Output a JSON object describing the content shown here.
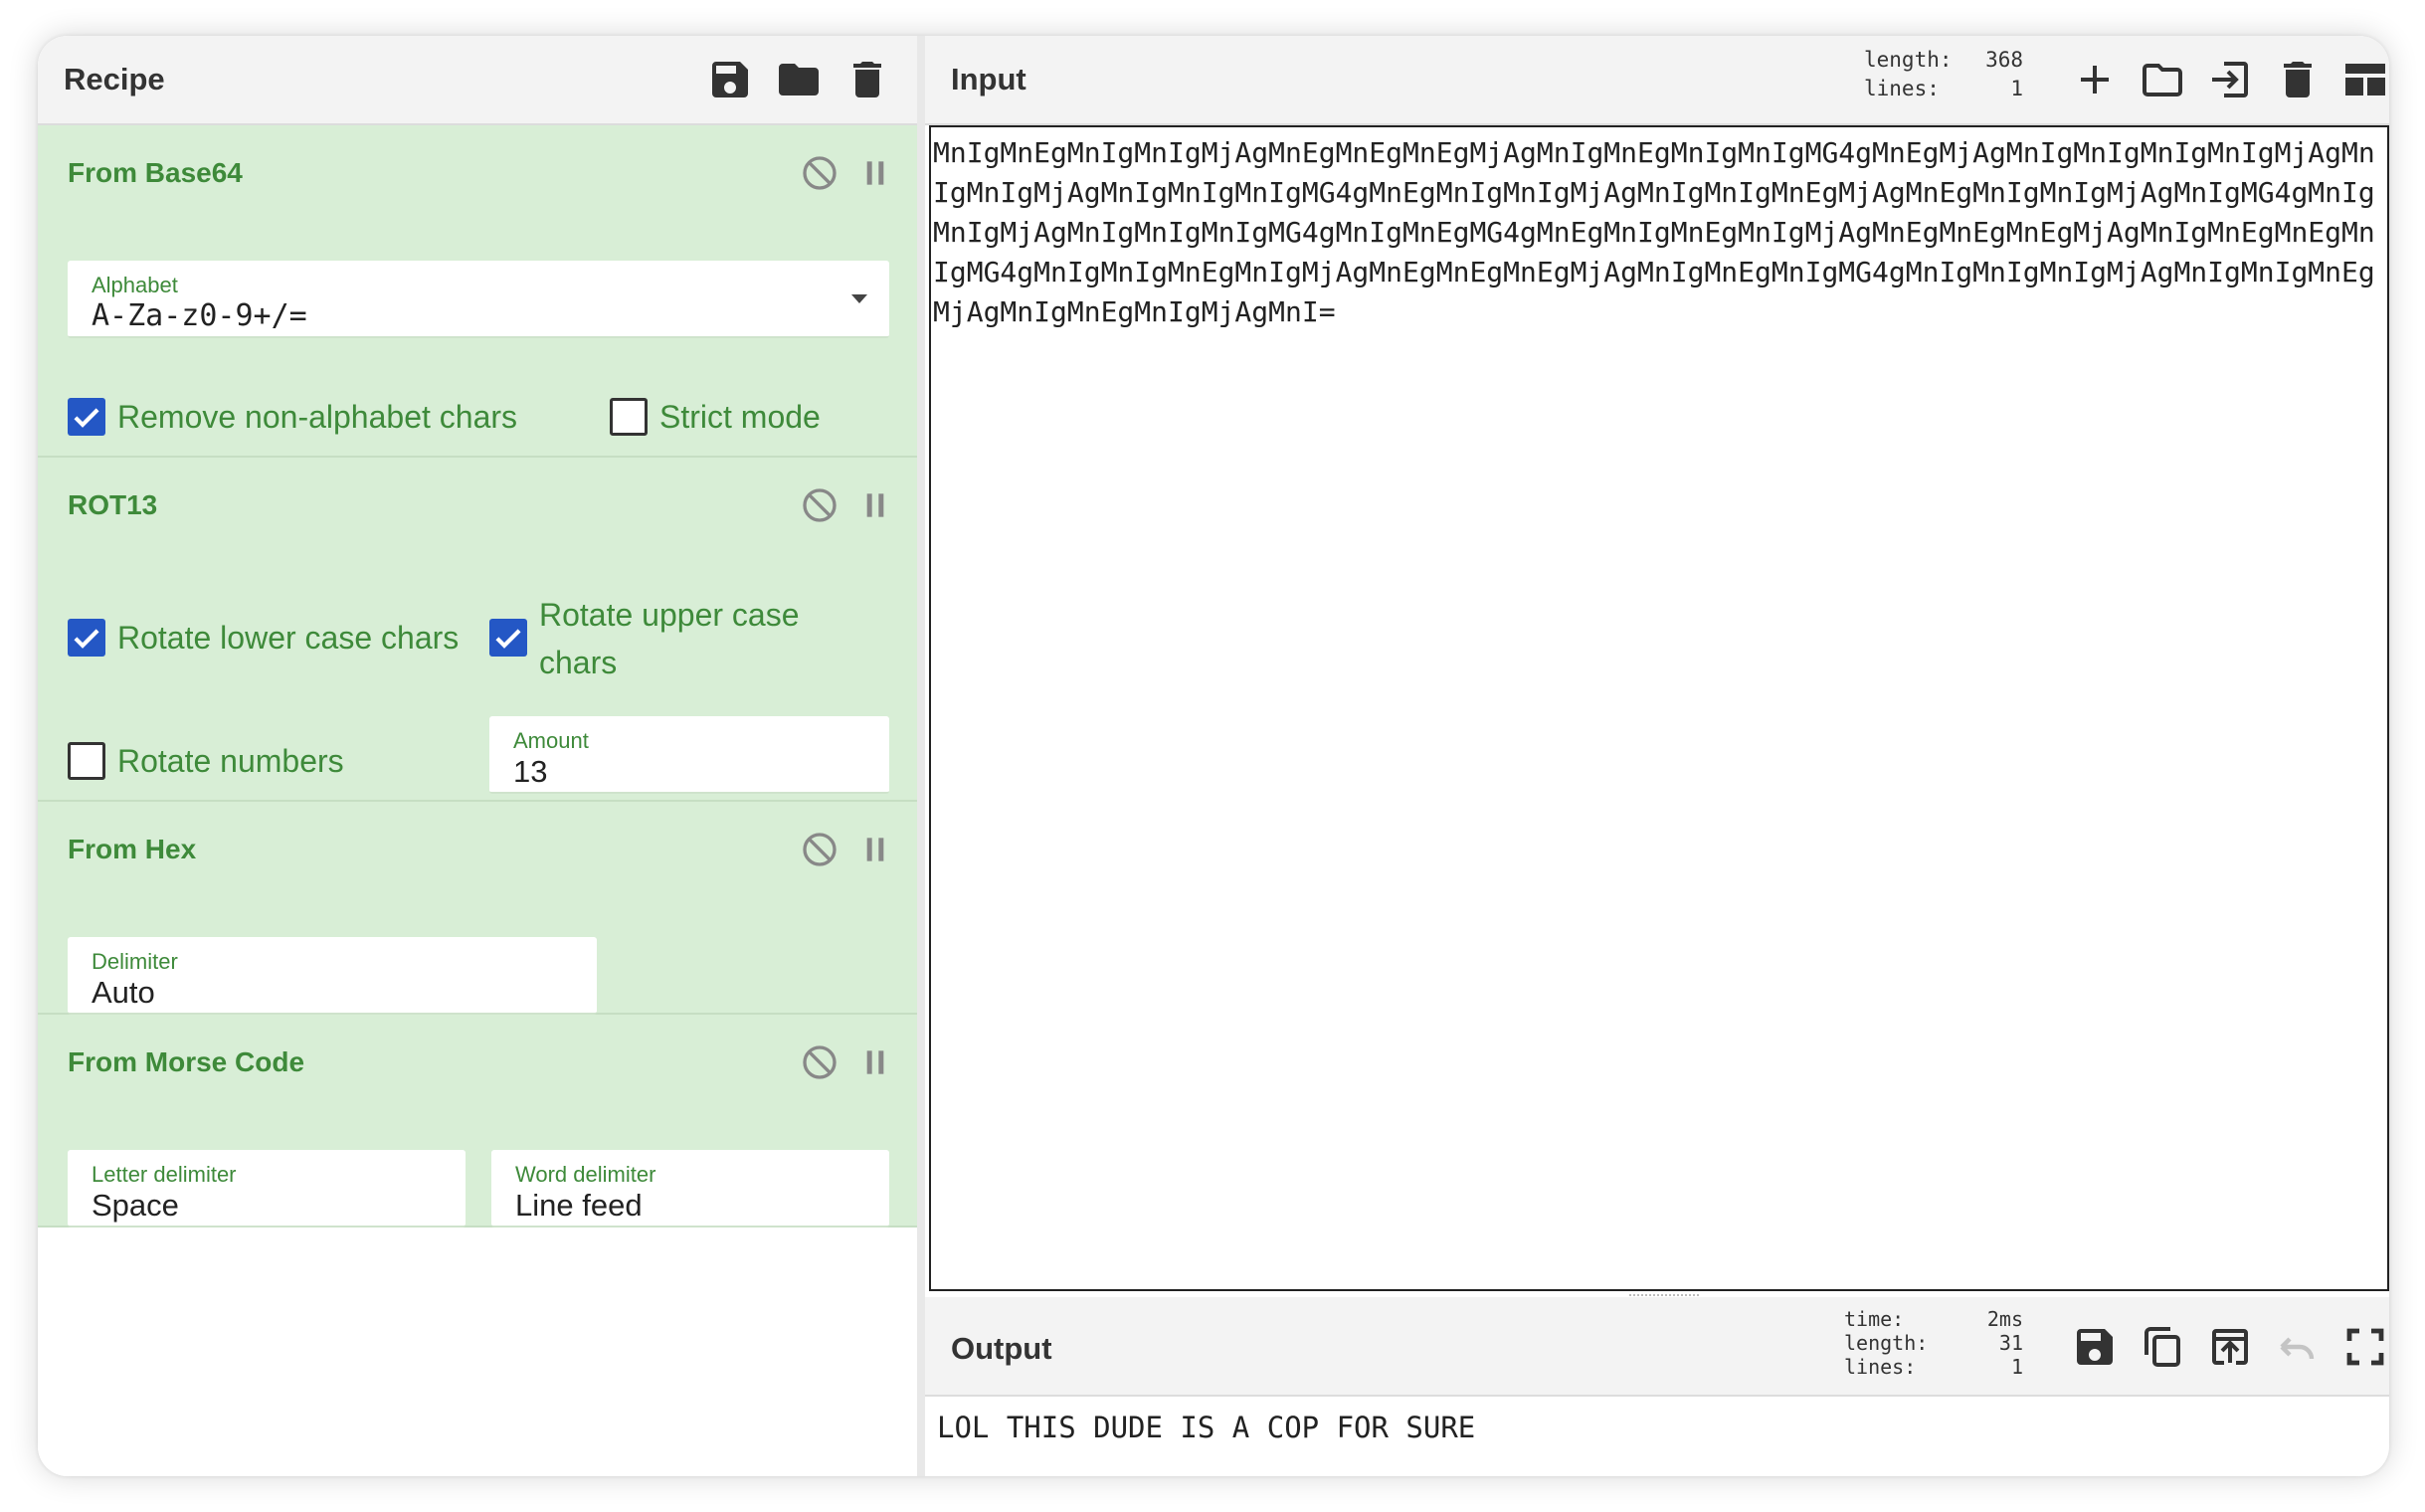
{
  "recipe": {
    "title": "Recipe",
    "icons": [
      "save-icon",
      "folder-icon",
      "trash-icon"
    ],
    "operations": [
      {
        "name": "From Base64",
        "fields": [
          {
            "label": "Alphabet",
            "value": "A-Za-z0-9+/=",
            "type": "dropdown"
          }
        ],
        "checkboxes": [
          {
            "label": "Remove non-alphabet chars",
            "checked": true
          },
          {
            "label": "Strict mode",
            "checked": false
          }
        ]
      },
      {
        "name": "ROT13",
        "checkboxes": [
          {
            "label": "Rotate lower case chars",
            "checked": true
          },
          {
            "label_line1": "Rotate upper case",
            "label_line2": "chars",
            "checked": true
          },
          {
            "label": "Rotate numbers",
            "checked": false
          }
        ],
        "fields": [
          {
            "label": "Amount",
            "value": "13"
          }
        ]
      },
      {
        "name": "From Hex",
        "fields": [
          {
            "label": "Delimiter",
            "value": "Auto"
          }
        ]
      },
      {
        "name": "From Morse Code",
        "fields": [
          {
            "label": "Letter delimiter",
            "value": "Space"
          },
          {
            "label": "Word delimiter",
            "value": "Line feed"
          }
        ]
      }
    ]
  },
  "input": {
    "title": "Input",
    "stats": [
      {
        "key": "length:",
        "value": "368"
      },
      {
        "key": "lines:",
        "value": "1"
      }
    ],
    "icons": [
      "plus-icon",
      "folder-icon",
      "import-icon",
      "trash-icon",
      "layout-icon"
    ],
    "text": "MnIgMnEgMnIgMnIgMjAgMnEgMnEgMnEgMjAgMnIgMnEgMnIgMnIgMG4gMnEgMjAgMnIgMnIgMnIgMnIgMjAgMnIgMnIgMjAgMnIgMnIgMnIgMG4gMnEgMnIgMnIgMjAgMnIgMnIgMnEgMjAgMnEgMnIgMnIgMjAgMnIgMG4gMnIgMnIgMjAgMnIgMnIgMnIgMG4gMnIgMnEgMG4gMnEgMnIgMnEgMnIgMjAgMnEgMnEgMnEgMjAgMnIgMnEgMnEgMnIgMG4gMnIgMnIgMnEgMnIgMjAgMnEgMnEgMnEgMjAgMnIgMnEgMnIgMG4gMnIgMnIgMnIgMjAgMnIgMnIgMnEgMjAgMnIgMnEgMnIgMjAgMnI="
  },
  "output": {
    "title": "Output",
    "stats": [
      {
        "key": "time:",
        "value": "2ms"
      },
      {
        "key": "length:",
        "value": "31"
      },
      {
        "key": "lines:",
        "value": "1"
      }
    ],
    "icons": [
      "save-icon",
      "copy-icon",
      "replace-input-icon",
      "undo-icon",
      "maximize-icon"
    ],
    "text": "LOL THIS DUDE IS A COP FOR SURE"
  },
  "colors": {
    "operation_bg": "#d8eed6",
    "operation_text": "#3e8a3a",
    "checkbox_checked": "#2457c5",
    "header_bg": "#f3f3f3"
  }
}
